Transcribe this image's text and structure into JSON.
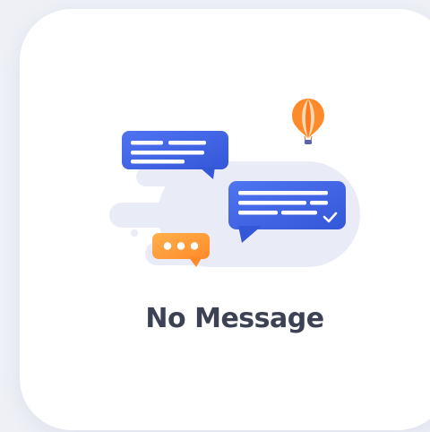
{
  "empty_state": {
    "title": "No Message"
  },
  "icons": {
    "illustration": "chat-bubbles-illustration",
    "balloon": "hot-air-balloon-icon"
  },
  "colors": {
    "background": "#eef0f6",
    "card": "#ffffff",
    "bubble_blue": "#3d63e6",
    "bubble_orange": "#ff9a3c",
    "cloud": "#e9ecf7",
    "title": "#3c4154"
  }
}
